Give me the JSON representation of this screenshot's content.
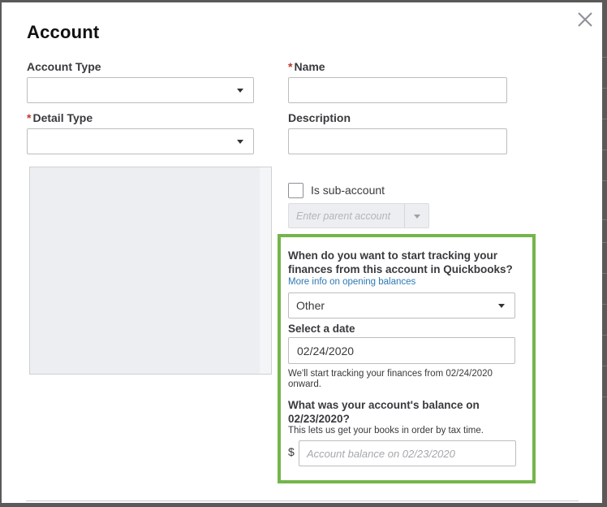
{
  "dialog": {
    "title": "Account",
    "close_label": "close"
  },
  "form": {
    "account_type": {
      "label": "Account Type",
      "value": ""
    },
    "detail_type": {
      "label": "Detail Type",
      "required_mark": "*",
      "value": ""
    },
    "name": {
      "label": "Name",
      "required_mark": "*",
      "value": ""
    },
    "description": {
      "label": "Description",
      "value": ""
    },
    "sub_account": {
      "label": "Is sub-account",
      "checked": false
    },
    "parent_account": {
      "placeholder": "Enter parent account"
    }
  },
  "opening_balance": {
    "question": "When do you want to start tracking your finances from this account in Quickbooks?",
    "question_line1": "When do you want to start tracking your",
    "question_line2": "finances from this account in Quickbooks?",
    "help_link": "More info on opening balances",
    "start_option": "Other",
    "date_label": "Select a date",
    "date_value": "02/24/2020",
    "date_note_line1": "We'll start tracking your finances from 02/24/2020",
    "date_note_line2": "onward.",
    "balance_question_line1": "What was your account's balance on",
    "balance_question_line2": "02/23/2020?",
    "balance_note": "This lets us get your books in order by tax time.",
    "currency_symbol": "$",
    "balance_placeholder": "Account balance on 02/23/2020",
    "highlight_color": "#74b54a"
  }
}
